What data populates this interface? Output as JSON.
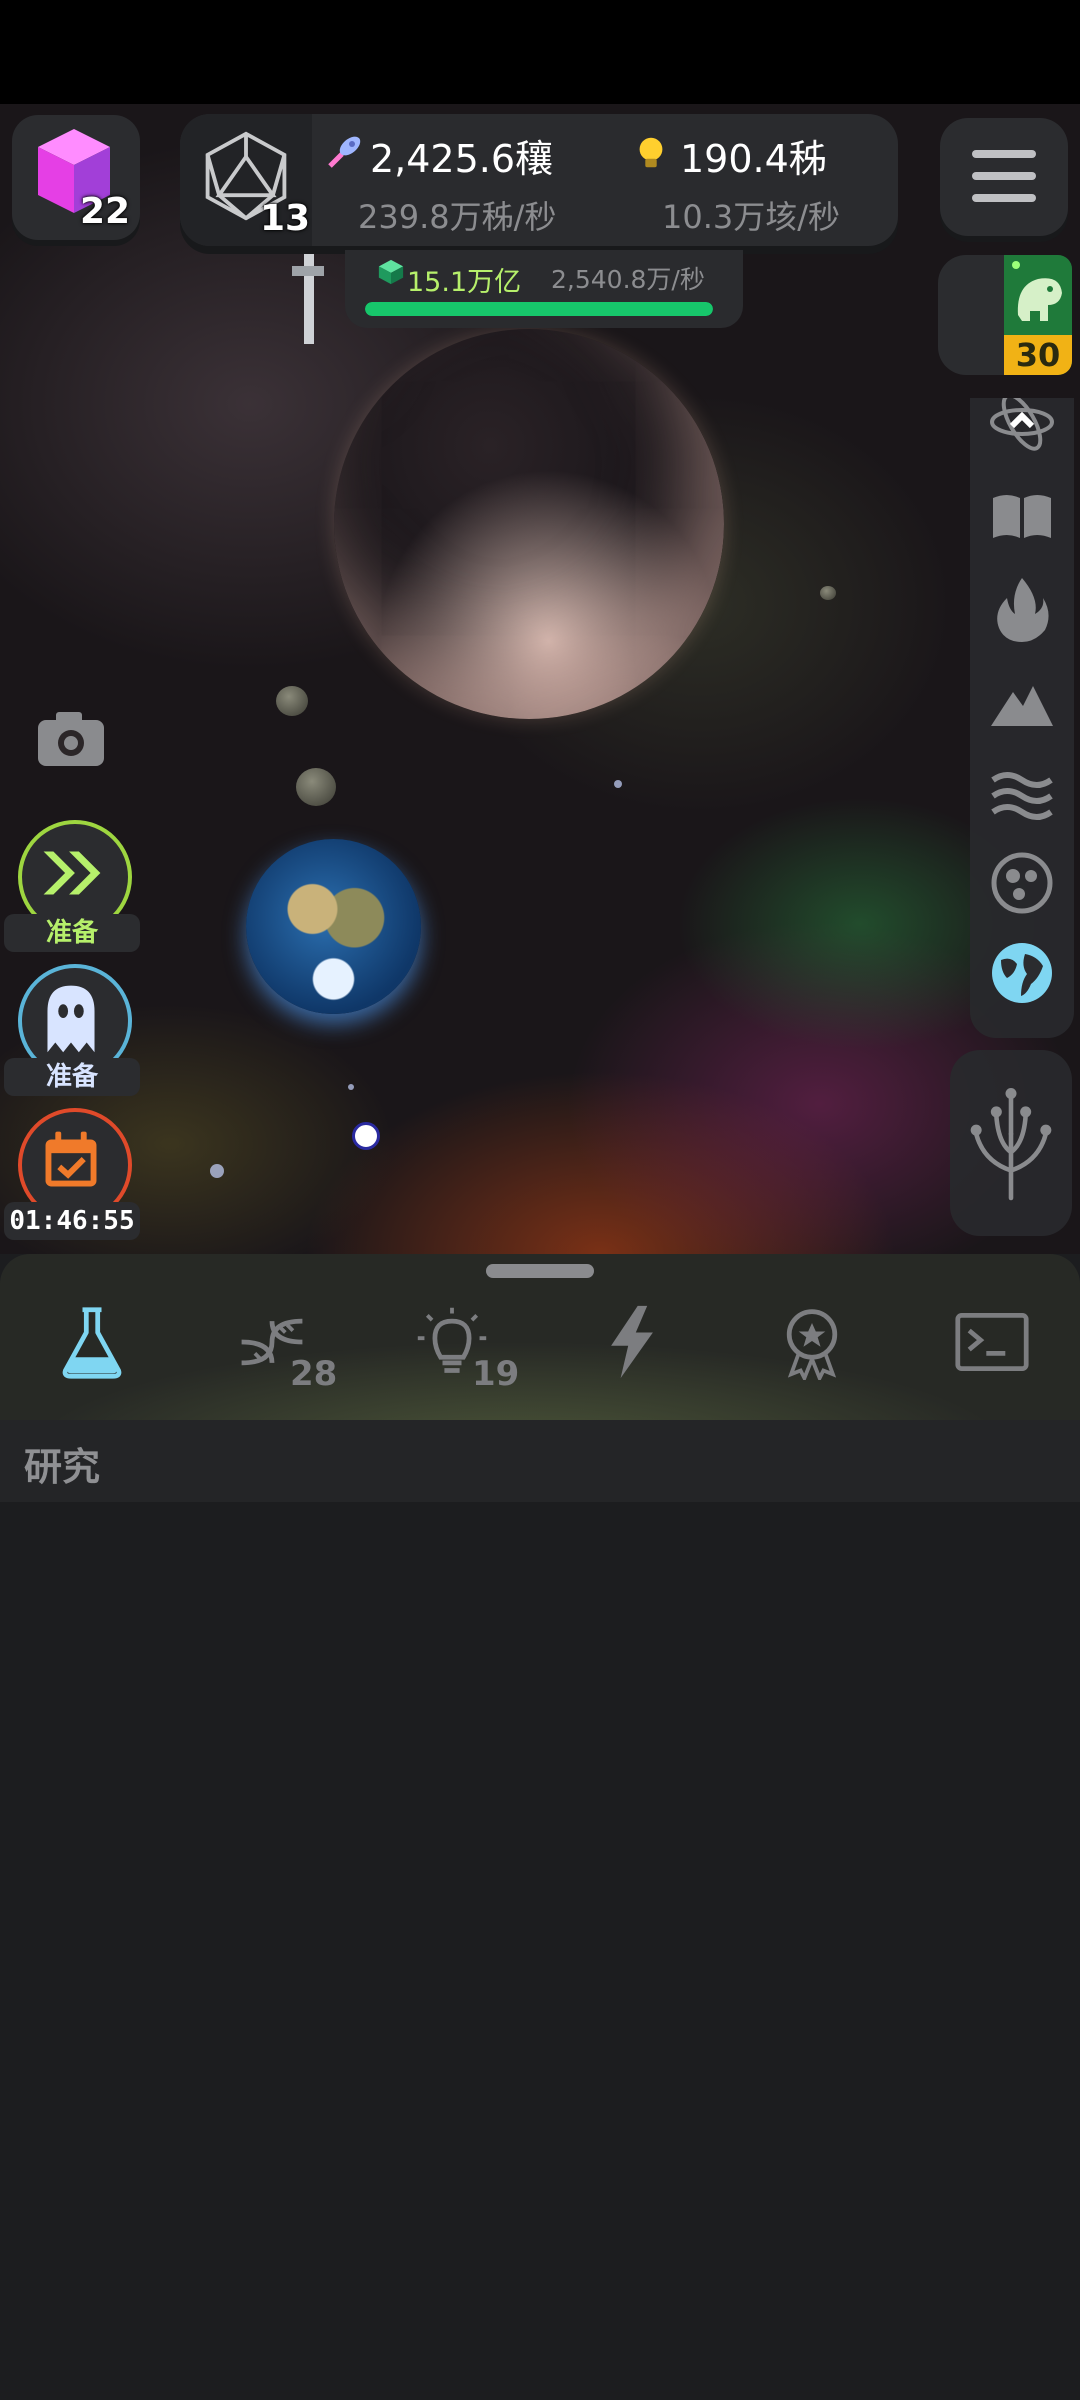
{
  "top_bar": {
    "cube_level": "22",
    "dice_level": "13",
    "primary_amount": "2,425.6穰",
    "primary_rate": "239.8万秭/秒",
    "ideas_amount": "190.4秭",
    "ideas_rate": "10.3万垓/秒",
    "gem_amount": "15.1万亿",
    "gem_rate": "2,540.8万/秒",
    "gem_progress": 1.0,
    "dino_count": "30"
  },
  "left_actions": {
    "speed_ready": "准备",
    "ghost_ready": "准备",
    "daily_timer": "01:46:55"
  },
  "bottom_tabs": [
    {
      "name": "research",
      "count": ""
    },
    {
      "name": "dna",
      "count": "28"
    },
    {
      "name": "ideas",
      "count": "19"
    },
    {
      "name": "power",
      "count": ""
    },
    {
      "name": "achievements",
      "count": ""
    },
    {
      "name": "console",
      "count": ""
    }
  ],
  "section": {
    "title": "研究"
  },
  "colors": {
    "accent_green": "#17c66b",
    "active_tab": "#7fd6f2",
    "ready_green": "#b6f06b",
    "timer_orange": "#f07a2a"
  }
}
